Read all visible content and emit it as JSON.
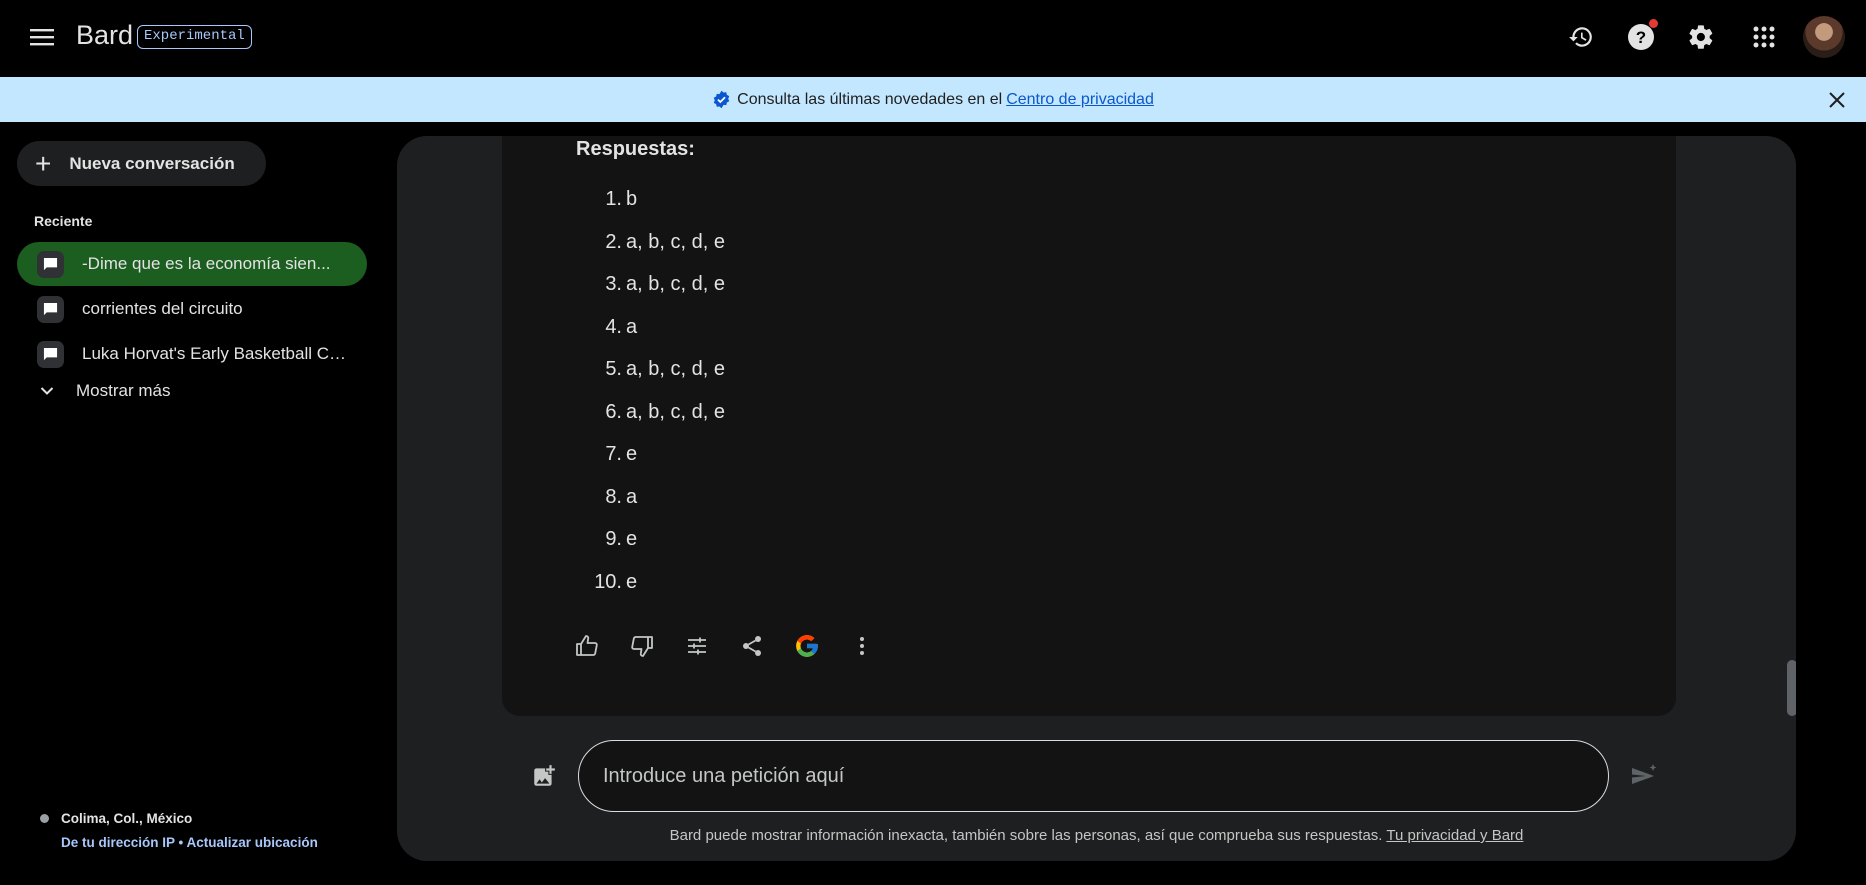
{
  "header": {
    "brand": "Bard",
    "badge": "Experimental",
    "icons": [
      "history-icon",
      "help-icon",
      "settings-icon",
      "apps-icon",
      "avatar"
    ]
  },
  "banner": {
    "text": "Consulta las últimas novedades en el",
    "link": "Centro de privacidad"
  },
  "sidebar": {
    "new_chat_label": "Nueva conversación",
    "recent_label": "Reciente",
    "conversations": [
      {
        "title": "-Dime que es la economía sien..."
      },
      {
        "title": "corrientes del circuito"
      },
      {
        "title": "Luka Horvat's Early Basketball Ca..."
      }
    ],
    "show_more_label": "Mostrar más",
    "location": {
      "place": "Colima, Col., México",
      "source": "De tu dirección IP",
      "separator": "•",
      "update": "Actualizar ubicación"
    }
  },
  "response": {
    "heading": "Respuestas:",
    "answers": [
      {
        "num": "1.",
        "text": "b"
      },
      {
        "num": "2.",
        "text": "a, b, c, d, e"
      },
      {
        "num": "3.",
        "text": "a, b, c, d, e"
      },
      {
        "num": "4.",
        "text": "a"
      },
      {
        "num": "5.",
        "text": "a, b, c, d, e"
      },
      {
        "num": "6.",
        "text": "a, b, c, d, e"
      },
      {
        "num": "7.",
        "text": "e"
      },
      {
        "num": "8.",
        "text": "a"
      },
      {
        "num": "9.",
        "text": "e"
      },
      {
        "num": "10.",
        "text": "e"
      }
    ],
    "actions": [
      "thumb-up-icon",
      "thumb-down-icon",
      "modify-icon",
      "share-icon",
      "google-icon",
      "more-icon"
    ]
  },
  "input": {
    "placeholder": "Introduce una petición aquí"
  },
  "footer": {
    "disclaimer": "Bard puede mostrar información inexacta, también sobre las personas, así que comprueba sus respuestas.",
    "link": "Tu privacidad y Bard"
  },
  "colors": {
    "active_conversation": "#1b5e20",
    "banner_bg": "#c2e7ff",
    "accent": "#a8c7fa"
  }
}
